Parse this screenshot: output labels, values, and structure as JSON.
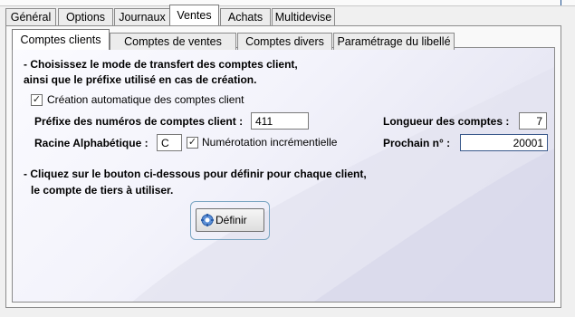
{
  "outer_tabs": [
    {
      "label": "Général"
    },
    {
      "label": "Options"
    },
    {
      "label": "Journaux"
    },
    {
      "label": "Ventes",
      "active": true
    },
    {
      "label": "Achats"
    },
    {
      "label": "Multidevise"
    }
  ],
  "inner_tabs": [
    {
      "label": "Comptes clients",
      "active": true
    },
    {
      "label": "Comptes de ventes"
    },
    {
      "label": "Comptes divers"
    },
    {
      "label": "Paramétrage du libellé"
    }
  ],
  "section1": {
    "line1": "- Choisissez le mode de transfert des comptes client,",
    "line2": "ainsi que le préfixe utilisé en cas de création."
  },
  "auto_creation": {
    "label": "Création automatique des comptes client",
    "checked": true
  },
  "prefix": {
    "label": "Préfixe des numéros de comptes client :",
    "value": "411"
  },
  "length": {
    "label": "Longueur des comptes :",
    "value": "7"
  },
  "root": {
    "label": "Racine Alphabétique :",
    "value": "C"
  },
  "incremental": {
    "label": "Numérotation incrémentielle",
    "checked": true
  },
  "next": {
    "label": "Prochain n° :",
    "value": "20001"
  },
  "section2": {
    "line1": "- Cliquez sur le bouton ci-dessous pour définir pour chaque client,",
    "line2": "le compte de tiers à utiliser."
  },
  "define_button": {
    "label": "Définir",
    "icon": "gear-icon"
  },
  "colors": {
    "focus_border": "#3b5a8c",
    "button_frame": "#7aa5c2"
  }
}
